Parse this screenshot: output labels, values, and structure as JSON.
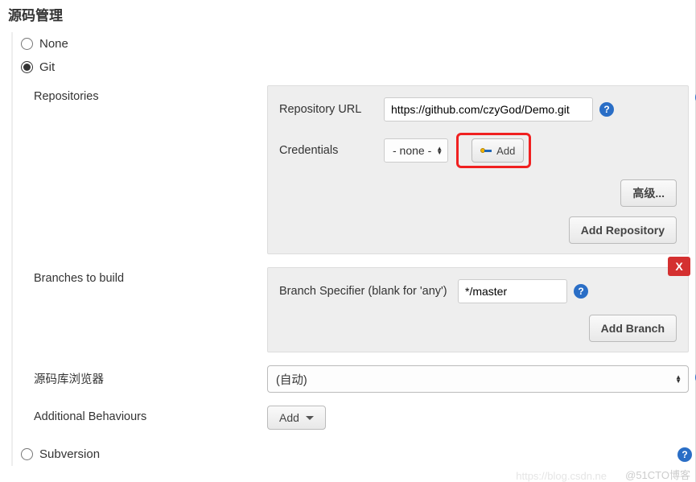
{
  "section_title": "源码管理",
  "scm": {
    "none_label": "None",
    "git_label": "Git",
    "subversion_label": "Subversion",
    "selected": "git"
  },
  "git": {
    "repositories_label": "Repositories",
    "repo_url_label": "Repository URL",
    "repo_url_value": "https://github.com/czyGod/Demo.git",
    "credentials_label": "Credentials",
    "credentials_value": "- none -",
    "add_credentials_label": "Add",
    "advanced_label": "高级...",
    "add_repo_label": "Add Repository",
    "branches_label": "Branches to build",
    "branch_specifier_label": "Branch Specifier (blank for 'any')",
    "branch_specifier_value": "*/master",
    "add_branch_label": "Add Branch",
    "delete_label": "X"
  },
  "browser": {
    "label": "源码库浏览器",
    "value": "(自动)"
  },
  "behaviours": {
    "label": "Additional Behaviours",
    "add_label": "Add"
  },
  "help_glyph": "?",
  "watermark": "@51CTO博客",
  "watermark2": "https://blog.csdn.ne"
}
